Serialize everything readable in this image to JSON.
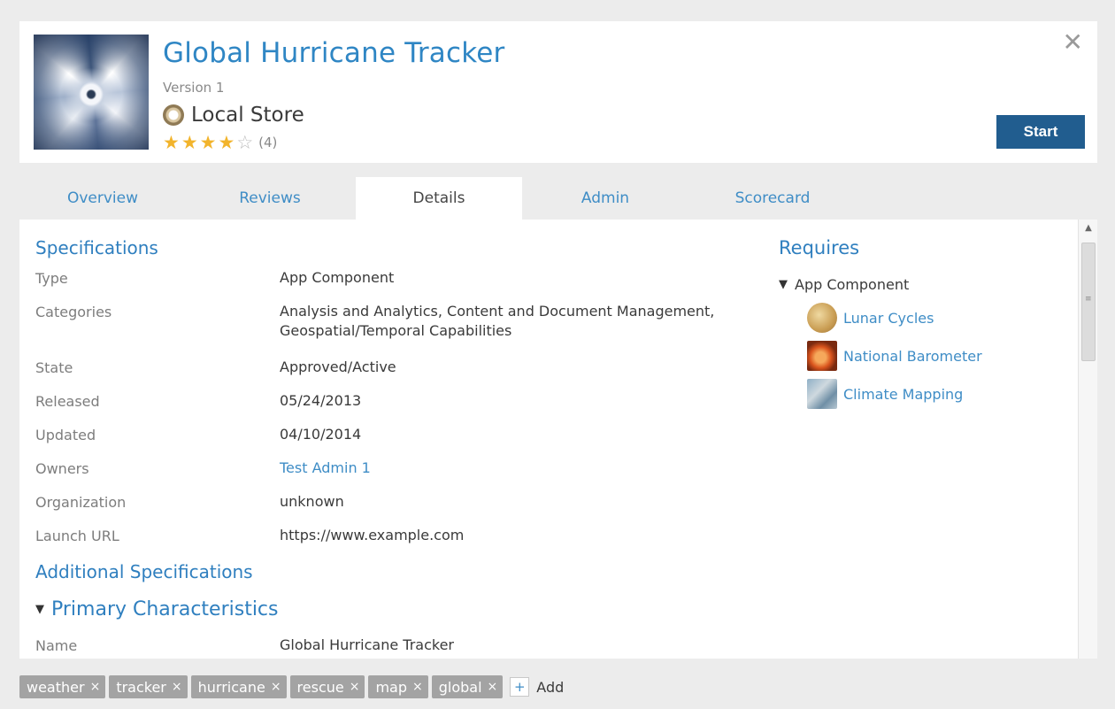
{
  "header": {
    "title": "Global Hurricane Tracker",
    "version": "Version 1",
    "store": "Local Store",
    "rating": {
      "stars": 4,
      "max": 5,
      "count": "(4)"
    },
    "close_glyph": "✕",
    "start_label": "Start"
  },
  "tabs": [
    {
      "label": "Overview",
      "active": false
    },
    {
      "label": "Reviews",
      "active": false
    },
    {
      "label": "Details",
      "active": true
    },
    {
      "label": "Admin",
      "active": false
    },
    {
      "label": "Scorecard",
      "active": false
    }
  ],
  "details": {
    "specifications_title": "Specifications",
    "rows": [
      {
        "label": "Type",
        "value": "App Component"
      },
      {
        "label": "Categories",
        "value": "Analysis and Analytics, Content and Document Management, Geospatial/Temporal Capabilities"
      },
      {
        "label": "State",
        "value": "Approved/Active"
      },
      {
        "label": "Released",
        "value": "05/24/2013"
      },
      {
        "label": "Updated",
        "value": "04/10/2014"
      },
      {
        "label": "Owners",
        "value": "Test Admin 1"
      },
      {
        "label": "Organization",
        "value": "unknown"
      },
      {
        "label": "Launch URL",
        "value": "https://www.example.com"
      }
    ],
    "additional_title": "Additional Specifications",
    "primary_title": "Primary Characteristics",
    "primary_rows": [
      {
        "label": "Name",
        "value": "Global Hurricane Tracker"
      }
    ]
  },
  "requires": {
    "title": "Requires",
    "group": "App Component",
    "items": [
      {
        "label": "Lunar Cycles",
        "icon": "moon-icon"
      },
      {
        "label": "National Barometer",
        "icon": "barometer-icon"
      },
      {
        "label": "Climate Mapping",
        "icon": "climate-map-icon"
      }
    ]
  },
  "tags": [
    "weather",
    "tracker",
    "hurricane",
    "rescue",
    "map",
    "global"
  ],
  "tag_remove_glyph": "×",
  "add_tag": {
    "plus": "+",
    "label": "Add"
  },
  "colors": {
    "accent": "#2f86c4",
    "start_button": "#215d8f",
    "star": "#f2b42c",
    "tag": "#a3a3a3"
  }
}
